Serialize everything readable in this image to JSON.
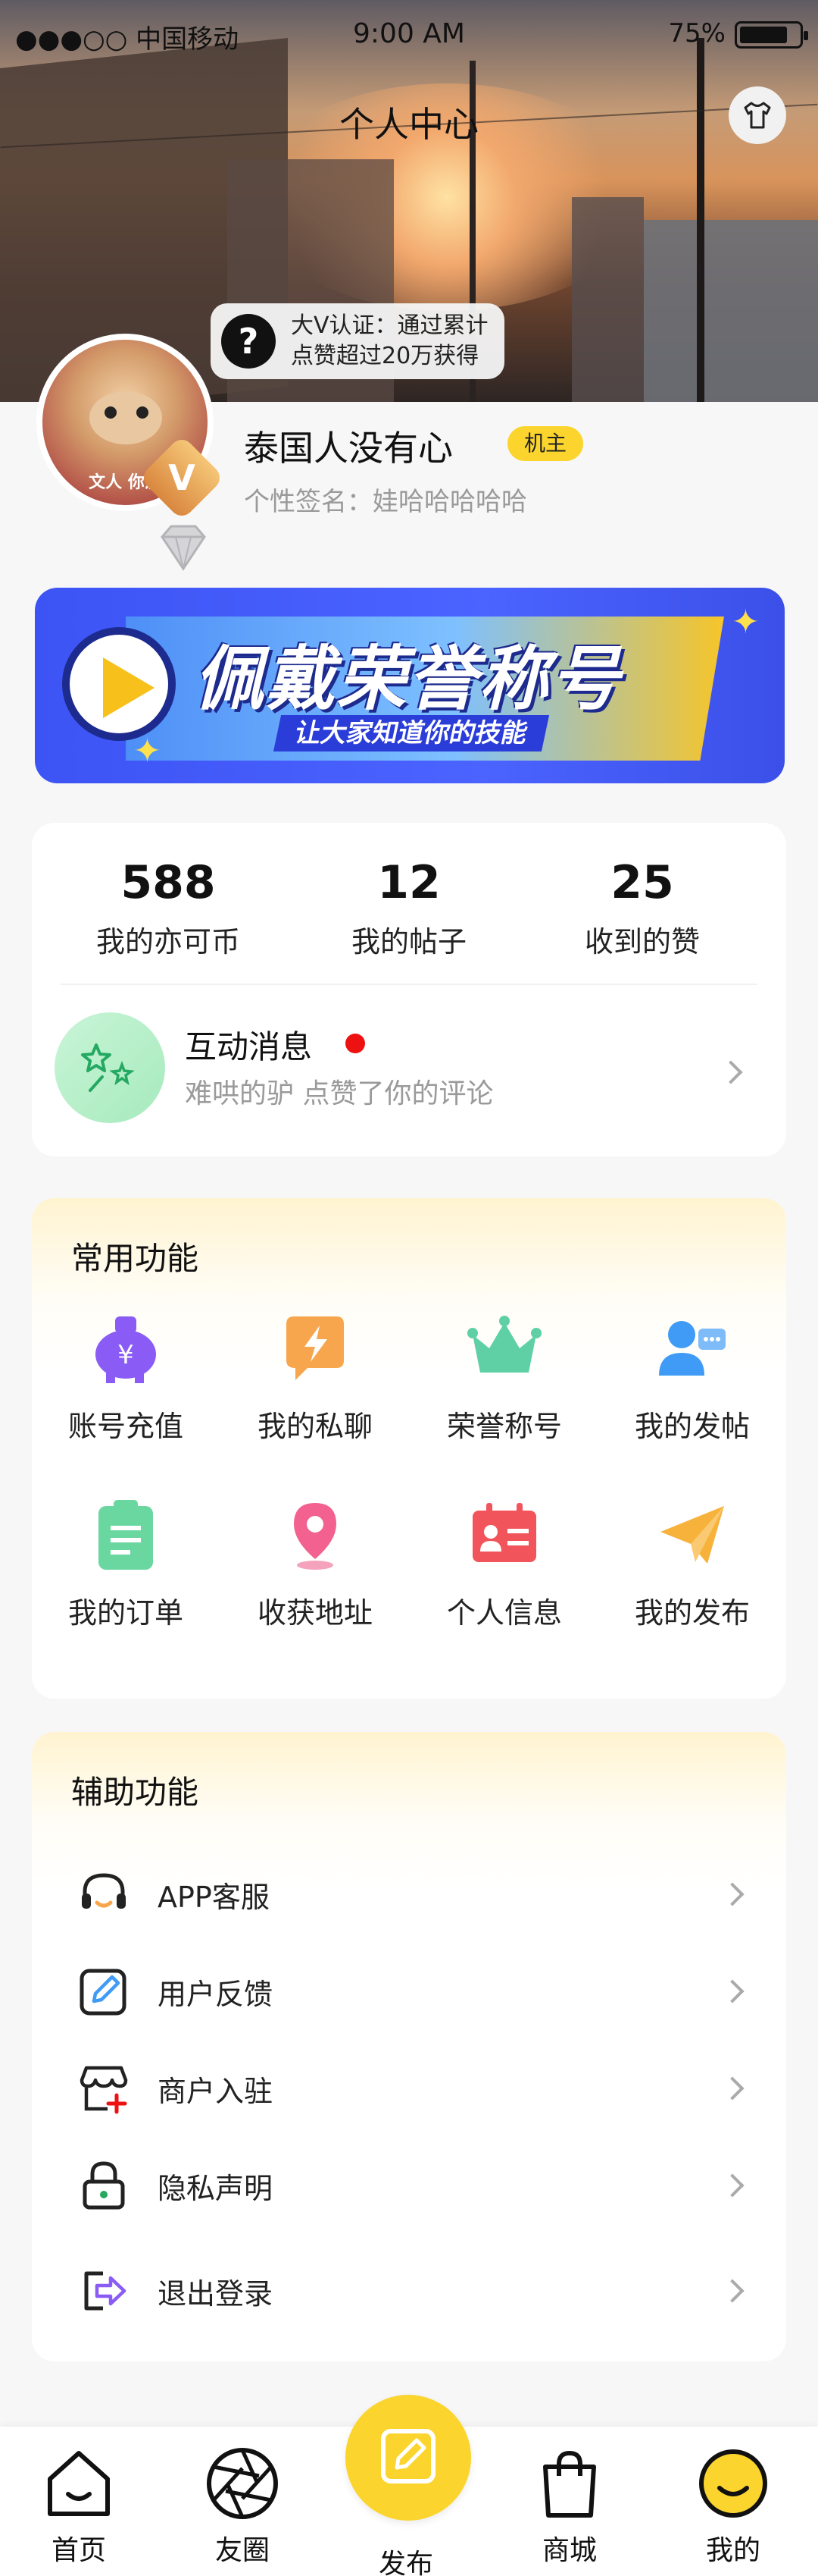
{
  "status_bar": {
    "carrier": "●●●○○ 中国移动",
    "time": "9:00 AM",
    "battery": "75%"
  },
  "header": {
    "title": "个人中心",
    "shirt_icon": "shirt-icon"
  },
  "tooltip": {
    "icon": "question-icon",
    "line1": "大V认证：通过累计",
    "line2": "点赞超过20万获得"
  },
  "profile": {
    "avatar_caption": "文人 你没",
    "username": "泰国人没有心",
    "role_badge": "机主",
    "signature": "个性签名：娃哈哈哈哈哈",
    "level_badge": "V"
  },
  "banner": {
    "headline": "佩戴荣誉称号",
    "subline": "让大家知道你的技能"
  },
  "stats": [
    {
      "value": "588",
      "label": "我的亦可币"
    },
    {
      "value": "12",
      "label": "我的帖子"
    },
    {
      "value": "25",
      "label": "收到的赞"
    }
  ],
  "message": {
    "title": "互动消息",
    "subtitle": "难哄的驴 点赞了你的评论"
  },
  "common": {
    "title": "常用功能",
    "items": [
      {
        "label": "账号充值",
        "icon": "piggy-bank-icon",
        "color": "#8a5cf5"
      },
      {
        "label": "我的私聊",
        "icon": "lightning-chat-icon",
        "color": "#f7a64d"
      },
      {
        "label": "荣誉称号",
        "icon": "crown-icon",
        "color": "#5fd0a5"
      },
      {
        "label": "我的发帖",
        "icon": "user-message-icon",
        "color": "#3f9bf5"
      },
      {
        "label": "我的订单",
        "icon": "clipboard-icon",
        "color": "#6ad6a0"
      },
      {
        "label": "收获地址",
        "icon": "location-pin-icon",
        "color": "#f2618f"
      },
      {
        "label": "个人信息",
        "icon": "id-card-icon",
        "color": "#f2545b"
      },
      {
        "label": "我的发布",
        "icon": "paper-plane-icon",
        "color": "#f7b23b"
      }
    ]
  },
  "aux": {
    "title": "辅助功能",
    "items": [
      {
        "label": "APP客服",
        "icon": "headset-icon"
      },
      {
        "label": "用户反馈",
        "icon": "feedback-edit-icon"
      },
      {
        "label": "商户入驻",
        "icon": "store-add-icon"
      },
      {
        "label": "隐私声明",
        "icon": "lock-icon"
      },
      {
        "label": "退出登录",
        "icon": "logout-icon"
      }
    ]
  },
  "tabbar": {
    "items": [
      {
        "label": "首页",
        "icon": "home-icon"
      },
      {
        "label": "友圈",
        "icon": "aperture-icon"
      },
      {
        "label": "发布",
        "icon": "edit-icon"
      },
      {
        "label": "商城",
        "icon": "shopping-bag-icon"
      },
      {
        "label": "我的",
        "icon": "smile-icon"
      }
    ]
  }
}
